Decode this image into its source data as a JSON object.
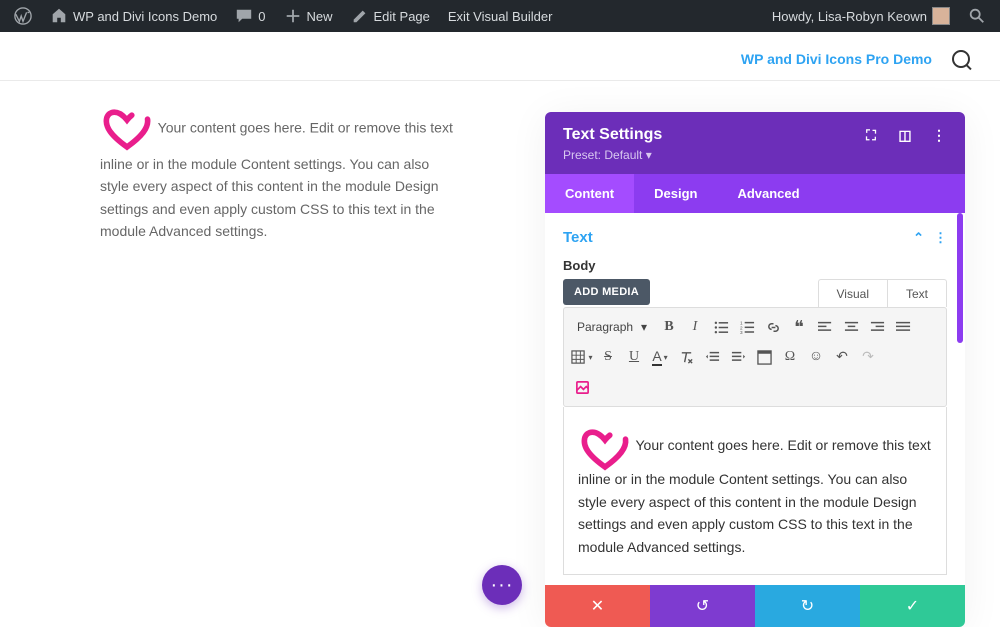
{
  "wpbar": {
    "site": "WP and Divi Icons Demo",
    "comments": "0",
    "new": "New",
    "edit": "Edit Page",
    "exit": "Exit Visual Builder",
    "greeting": "Howdy, Lisa-Robyn Keown"
  },
  "header": {
    "link": "WP and Divi Icons Pro Demo"
  },
  "left_text": "Your content goes here. Edit or remove this text inline or in the module Content settings. You can also style every aspect of this content in the module Design settings and even apply custom CSS to this text in the module Advanced settings.",
  "panel": {
    "title": "Text Settings",
    "preset": "Preset: Default",
    "tabs": {
      "content": "Content",
      "design": "Design",
      "advanced": "Advanced"
    },
    "section": "Text",
    "body_label": "Body",
    "add_media": "ADD MEDIA",
    "editor_tabs": {
      "visual": "Visual",
      "text": "Text"
    },
    "format_select": "Paragraph",
    "editor_text": "Your content goes here. Edit or remove this text inline or in the module Content settings. You can also style every aspect of this content in the module Design settings and even apply custom CSS to this text in the module Advanced settings."
  }
}
